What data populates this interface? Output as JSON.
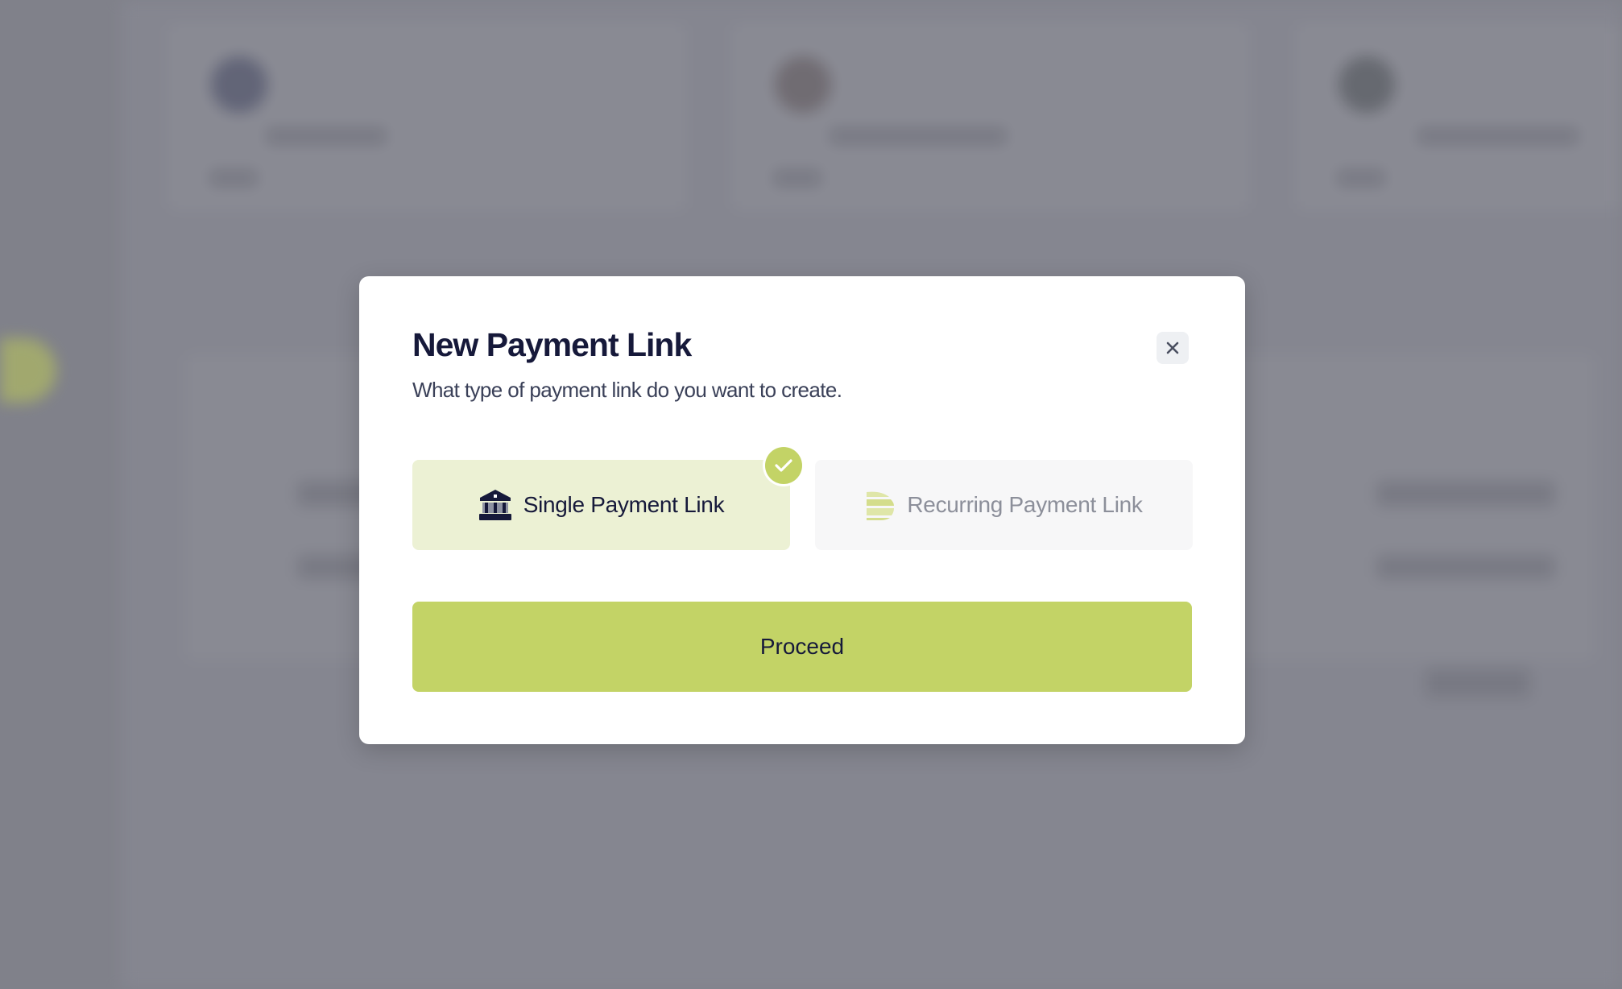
{
  "modal": {
    "title": "New Payment Link",
    "subtitle": "What type of payment link do you want to create.",
    "close_icon": "close-icon",
    "options": [
      {
        "label": "Single Payment Link",
        "icon": "bank-icon",
        "selected": true
      },
      {
        "label": "Recurring Payment Link",
        "icon": "recurring-stack-icon",
        "selected": false
      }
    ],
    "selected_badge_icon": "check-icon",
    "proceed_label": "Proceed"
  },
  "colors": {
    "accent": "#c3d366",
    "accent_light": "#ecf1d4",
    "title_text": "#16193a",
    "overlay": "#80818a"
  }
}
